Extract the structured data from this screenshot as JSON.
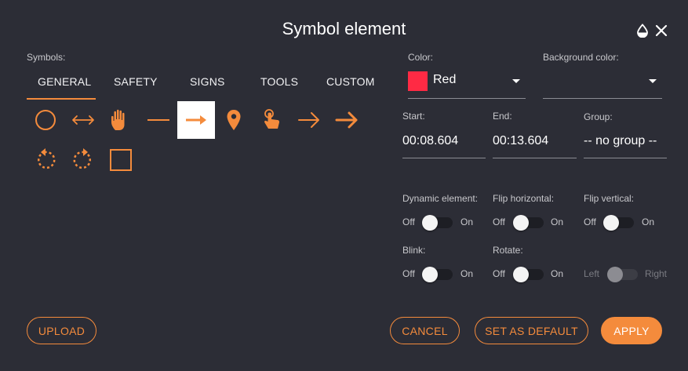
{
  "dialog": {
    "title": "Symbol element"
  },
  "symbols": {
    "label": "Symbols:",
    "tabs": [
      {
        "label": "GENERAL",
        "active": true
      },
      {
        "label": "SAFETY"
      },
      {
        "label": "SIGNS"
      },
      {
        "label": "TOOLS"
      },
      {
        "label": "CUSTOM"
      }
    ],
    "items": [
      {
        "icon": "circle-icon"
      },
      {
        "icon": "double-arrow-icon"
      },
      {
        "icon": "hand-icon"
      },
      {
        "icon": "line-icon"
      },
      {
        "icon": "arrow-right-icon",
        "selected": true
      },
      {
        "icon": "map-pin-icon"
      },
      {
        "icon": "touch-icon"
      },
      {
        "icon": "arrow-right-thin-icon"
      },
      {
        "icon": "arrow-right-bold-icon"
      },
      {
        "icon": "rotate-left-icon"
      },
      {
        "icon": "rotate-right-icon"
      },
      {
        "icon": "square-icon"
      }
    ],
    "accent_color": "#f48b3c"
  },
  "color": {
    "label": "Color:",
    "value": "Red",
    "swatch": "#ff2a44"
  },
  "background_color": {
    "label": "Background color:",
    "value": ""
  },
  "start": {
    "label": "Start:",
    "value": "00:08.604"
  },
  "end": {
    "label": "End:",
    "value": "00:13.604"
  },
  "group": {
    "label": "Group:",
    "value": "-- no group --"
  },
  "toggles": {
    "off": "Off",
    "on": "On",
    "left": "Left",
    "right": "Right",
    "dynamic": {
      "label": "Dynamic element:",
      "on": false
    },
    "flip_horizontal": {
      "label": "Flip horizontal:",
      "on": false
    },
    "flip_vertical": {
      "label": "Flip vertical:",
      "on": false
    },
    "blink": {
      "label": "Blink:",
      "on": false
    },
    "rotate": {
      "label": "Rotate:",
      "on": false
    },
    "rotate_direction": {
      "disabled": true
    }
  },
  "buttons": {
    "upload": "UPLOAD",
    "cancel": "CANCEL",
    "set_default": "SET AS DEFAULT",
    "apply": "APPLY"
  }
}
